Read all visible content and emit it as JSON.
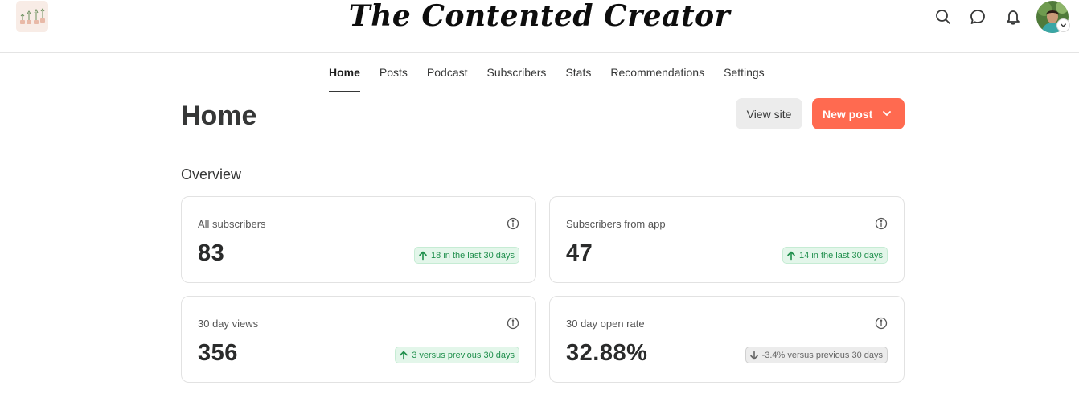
{
  "header": {
    "site_title": "The Contented Creator",
    "icons": [
      "search-icon",
      "chat-icon",
      "bell-icon",
      "avatar"
    ]
  },
  "nav": {
    "items": [
      {
        "label": "Home",
        "active": true
      },
      {
        "label": "Posts"
      },
      {
        "label": "Podcast"
      },
      {
        "label": "Subscribers"
      },
      {
        "label": "Stats"
      },
      {
        "label": "Recommendations"
      },
      {
        "label": "Settings"
      }
    ]
  },
  "page": {
    "title": "Home",
    "view_site_label": "View site",
    "new_post_label": "New post"
  },
  "overview": {
    "title": "Overview",
    "cards": [
      {
        "label": "All subscribers",
        "value": "83",
        "trend": "18 in the last 30 days",
        "direction": "up"
      },
      {
        "label": "Subscribers from app",
        "value": "47",
        "trend": "14 in the last 30 days",
        "direction": "up"
      },
      {
        "label": "30 day views",
        "value": "356",
        "trend": "3 versus previous 30 days",
        "direction": "up"
      },
      {
        "label": "30 day open rate",
        "value": "32.88%",
        "trend": "-3.4% versus previous 30 days",
        "direction": "down"
      }
    ]
  },
  "colors": {
    "accent": "#ff6a50",
    "positive_text": "#1f8f4c",
    "positive_bg": "#e3f6ea",
    "neutral_bg": "#ececec"
  }
}
